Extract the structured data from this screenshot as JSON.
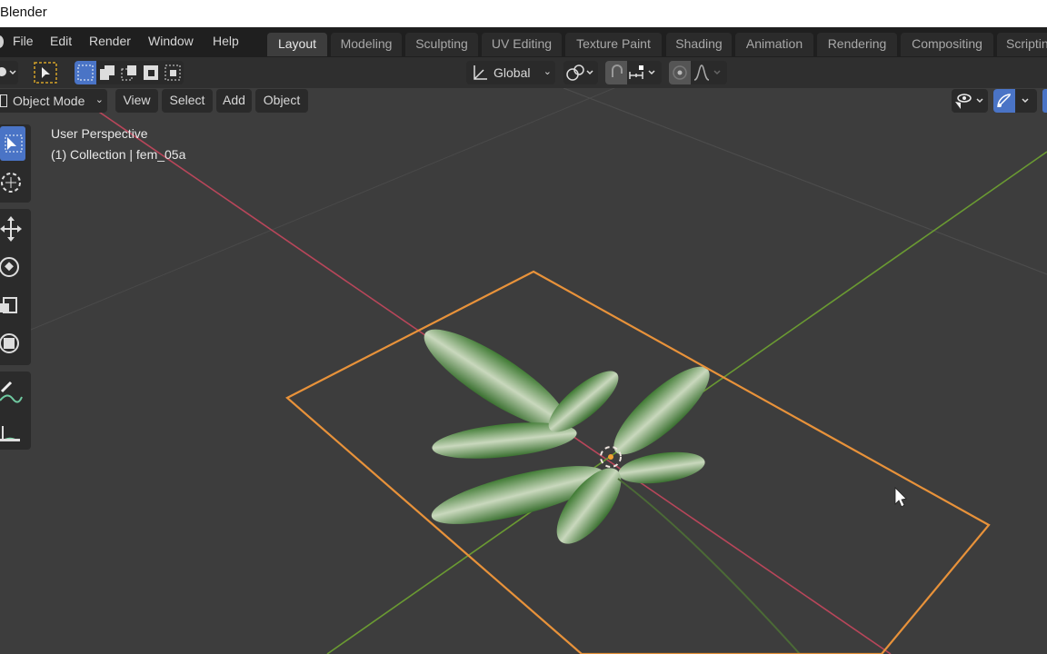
{
  "window": {
    "title": "Blender"
  },
  "menu": {
    "items": [
      "File",
      "Edit",
      "Render",
      "Window",
      "Help"
    ]
  },
  "workspaces": {
    "tabs": [
      "Layout",
      "Modeling",
      "Sculpting",
      "UV Editing",
      "Texture Paint",
      "Shading",
      "Animation",
      "Rendering",
      "Compositing",
      "Scripting"
    ],
    "active": "Layout"
  },
  "tool_header": {
    "transform_orientation": "Global",
    "icons": [
      "tool-settings-icon",
      "select-tool-icon",
      "mode-new-selection-icon",
      "mode-extend-icon",
      "mode-subtract-icon",
      "mode-invert-icon",
      "mode-intersect-icon",
      "orientation-icon",
      "pivot-icon",
      "snap-icon",
      "snap-increment-icon",
      "proportional-edit-icon",
      "falloff-icon"
    ]
  },
  "viewport_header": {
    "mode": "Object Mode",
    "menus": [
      "View",
      "Select",
      "Add",
      "Object"
    ]
  },
  "viewport": {
    "view_name": "User Perspective",
    "collection_info": "(1) Collection | fem_05a",
    "selection_color": "#e8923a",
    "x_axis_color": "#b8465a",
    "y_axis_color": "#6a9a32",
    "background_color": "#3d3d3d",
    "object": "fem_05a"
  },
  "toolbar": {
    "tools": [
      "select-box",
      "cursor",
      "move",
      "rotate",
      "scale",
      "transform",
      "annotate",
      "measure"
    ],
    "active_tool": "select-box"
  }
}
